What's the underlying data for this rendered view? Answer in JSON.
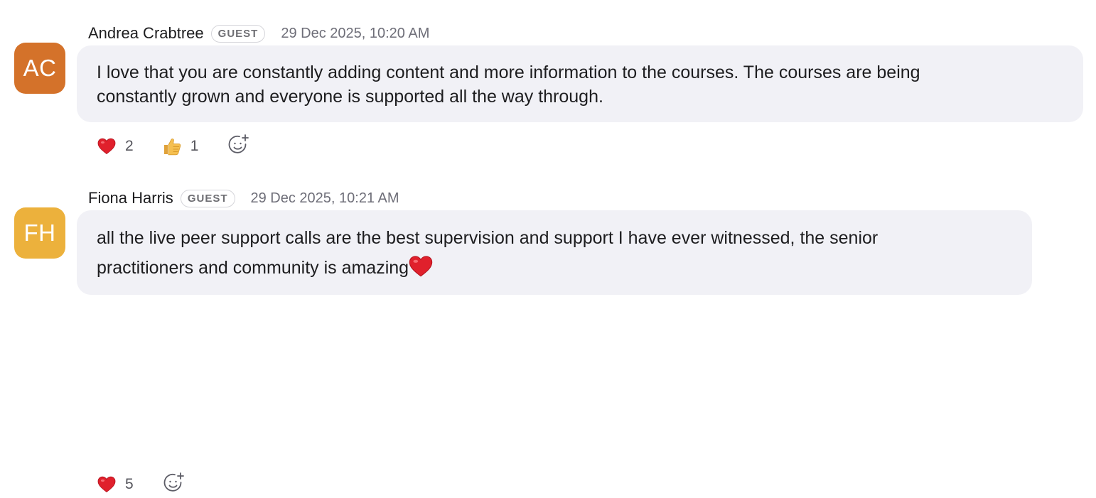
{
  "messages": [
    {
      "avatar": {
        "initials": "AC",
        "color": "#d4722a"
      },
      "author": "Andrea Crabtree",
      "badge": "GUEST",
      "timestamp": "29 Dec 2025, 10:20 AM",
      "text": "I love that you are constantly adding content and more information to the courses. The courses are being\nconstantly grown and everyone is supported all the way through.",
      "reactions": [
        {
          "icon": "red-heart-icon",
          "count": "2"
        },
        {
          "icon": "thumbs-up-icon",
          "count": "1"
        }
      ]
    },
    {
      "avatar": {
        "initials": "FH",
        "color": "#ecb13c"
      },
      "author": "Fiona Harris",
      "badge": "GUEST",
      "timestamp": "29 Dec 2025, 10:21 AM",
      "text": "all the live peer support calls are the best supervision and support I have ever witnessed, the senior\npractitioners and community is amazing",
      "trailing_icon": "red-heart-icon",
      "reactions": [
        {
          "icon": "red-heart-icon",
          "count": "5"
        }
      ]
    }
  ],
  "add_reaction_icon": "add-emoji-icon",
  "colors": {
    "bubble_bg": "#f1f1f6",
    "heart": "#e0202c",
    "badge_border": "#d5d5da",
    "meta_text": "#6e6e78"
  }
}
